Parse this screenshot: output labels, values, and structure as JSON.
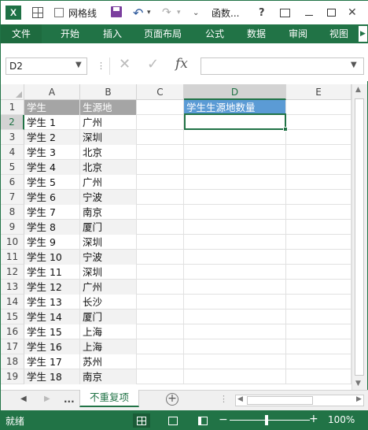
{
  "window": {
    "app_icon": "X",
    "gridlines_label": "网格线",
    "gridlines_checked": false,
    "doc_title": "函数...",
    "help": "?",
    "close": "✕",
    "icons": [
      "excel-icon",
      "gridlines-icon",
      "save-icon",
      "undo-icon",
      "redo-icon",
      "restore-ribbon-icon",
      "minimize-icon",
      "maximize-icon",
      "close-icon"
    ]
  },
  "ribbon": {
    "file_tab": "文件",
    "tabs": [
      "开始",
      "插入",
      "页面布局",
      "公式",
      "数据",
      "审阅",
      "视图"
    ],
    "accent_color": "#217346"
  },
  "formula_bar": {
    "name_box": "D2",
    "fx": "fx",
    "formula": ""
  },
  "grid": {
    "columns": [
      "A",
      "B",
      "C",
      "D",
      "E"
    ],
    "selected_column": "D",
    "selected_row": 2,
    "rows": [
      1,
      2,
      3,
      4,
      5,
      6,
      7,
      8,
      9,
      10,
      11,
      12,
      13,
      14,
      15,
      16,
      17,
      18,
      19
    ],
    "header_row": {
      "A": "学生",
      "B": "生源地",
      "D": "学生生源地数量"
    },
    "data": [
      {
        "student": "学生 1",
        "origin": "广州"
      },
      {
        "student": "学生 2",
        "origin": "深圳"
      },
      {
        "student": "学生 3",
        "origin": "北京"
      },
      {
        "student": "学生 4",
        "origin": "北京"
      },
      {
        "student": "学生 5",
        "origin": "广州"
      },
      {
        "student": "学生 6",
        "origin": "宁波"
      },
      {
        "student": "学生 7",
        "origin": "南京"
      },
      {
        "student": "学生 8",
        "origin": "厦门"
      },
      {
        "student": "学生 9",
        "origin": "深圳"
      },
      {
        "student": "学生 10",
        "origin": "宁波"
      },
      {
        "student": "学生 11",
        "origin": "深圳"
      },
      {
        "student": "学生 12",
        "origin": "广州"
      },
      {
        "student": "学生 13",
        "origin": "长沙"
      },
      {
        "student": "学生 14",
        "origin": "厦门"
      },
      {
        "student": "学生 15",
        "origin": "上海"
      },
      {
        "student": "学生 16",
        "origin": "上海"
      },
      {
        "student": "学生 17",
        "origin": "苏州"
      },
      {
        "student": "学生 18",
        "origin": "南京"
      }
    ]
  },
  "sheets": {
    "more": "...",
    "active": "不重复项",
    "add": "+"
  },
  "status": {
    "text": "就绪",
    "zoom_minus": "−",
    "zoom_plus": "+",
    "zoom_level": "100%"
  }
}
